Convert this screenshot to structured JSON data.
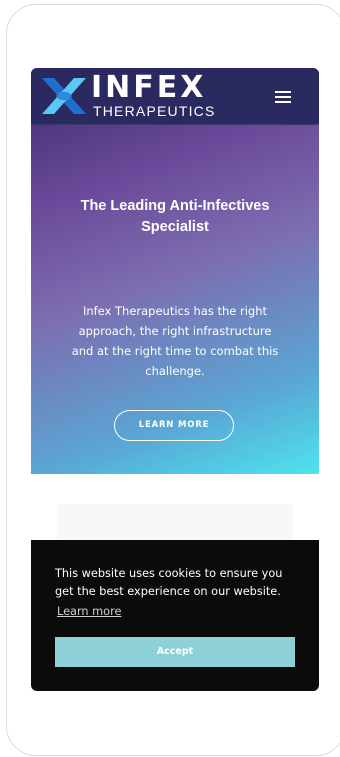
{
  "brand": {
    "name": "INFEX",
    "subtitle": "THERAPEUTICS",
    "logo_icon": "x-logo-icon",
    "colors": {
      "logo_dark": "#1f6fd0",
      "logo_light": "#5ac8f5"
    }
  },
  "header": {
    "menu_icon": "hamburger-menu-icon"
  },
  "hero": {
    "title": "The Leading Anti-Infectives Specialist",
    "body": "Infex Therapeutics has the right approach, the right infrastructure and at the right time to combat this challenge.",
    "cta_label": "LEARN MORE",
    "colors": {
      "top": "#3b2a6e",
      "bottom": "#4de3ef"
    }
  },
  "cookie_banner": {
    "message": "This website uses cookies to ensure you get the best experience on our website.",
    "link_label": "Learn more",
    "accept_label": "Accept",
    "colors": {
      "background": "#0b0b0b",
      "accept": "#8dd0d8"
    }
  },
  "lower_section": {
    "icon": "dotted-pattern-icon",
    "colors": {
      "dots": "#39d98a"
    }
  }
}
